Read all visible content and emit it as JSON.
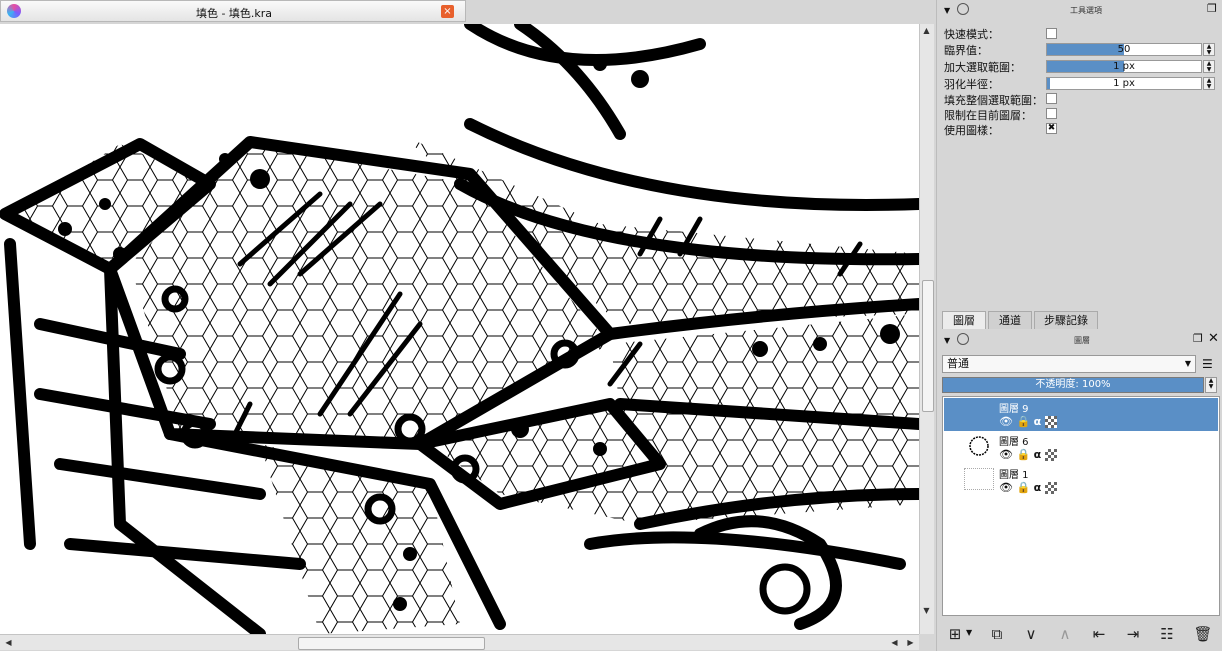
{
  "document": {
    "title": "填色 - 填色.kra",
    "close_symbol": "×"
  },
  "tool_options": {
    "header_title": "工具選項",
    "fast_mode_label": "快速模式：",
    "threshold_label": "臨界值：",
    "threshold_value": "50",
    "grow_selection_label": "加大選取範圍：",
    "grow_selection_value": "1 px",
    "feather_label": "羽化半徑：",
    "feather_value": "1 px",
    "fill_entire_label": "填充整個選取範圍：",
    "limit_layer_label": "限制在目前圖層：",
    "use_pattern_label": "使用圖樣：",
    "use_pattern_checked_symbol": "✖"
  },
  "docker_tabs": [
    {
      "label": "圖層",
      "active": true
    },
    {
      "label": "通道",
      "active": false
    },
    {
      "label": "步驟記錄",
      "active": false
    }
  ],
  "layers_panel": {
    "header_title": "圖層",
    "blend_mode": "普通",
    "opacity_label": "不透明度:  100%",
    "layers": [
      {
        "name": "圖層 9",
        "selected": true
      },
      {
        "name": "圖層 6",
        "selected": false
      },
      {
        "name": "圖層 1",
        "selected": false
      }
    ],
    "alpha_symbol": "α"
  },
  "colors": {
    "selection": "#5a8fc6",
    "panel_bg": "#d6d6d6"
  }
}
